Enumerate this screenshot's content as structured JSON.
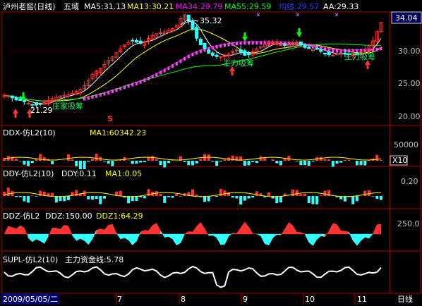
{
  "header": {
    "title": "泸州老窖(日线)",
    "subtitle": "五域",
    "indicators": [
      {
        "label": "MA5:31.13",
        "color": "#ffffff"
      },
      {
        "label": "MA13:30.21",
        "color": "#ffff00"
      },
      {
        "label": "MA34:29.79",
        "color": "#ff00ff"
      },
      {
        "label": "MA55:29.59",
        "color": "#00ff00"
      },
      {
        "label": "均线:29.57",
        "color": "#3333ff"
      },
      {
        "label": "AA:29.33",
        "color": "#ffffff"
      }
    ]
  },
  "price_panel": {
    "current_price": "34.04",
    "peak_label": "35.32",
    "low_label": "21.29",
    "axis_labels": [
      "30.00",
      "25.00",
      "20.00"
    ],
    "signal_text": "S",
    "note_texts": [
      "庄家吸筹",
      "主力吸筹",
      "主力吸筹"
    ]
  },
  "ddx_panel": {
    "name": "DDX-仿L2(10)",
    "ma_label": "MA1:60342.23",
    "axis_label": "50000",
    "unit_label": "X10"
  },
  "ddy_panel": {
    "name": "DDY-仿L2(10)",
    "value_label": "DDY:0.11",
    "ma_label": "MA1:0.05",
    "axis_label": "0.20"
  },
  "ddz_panel": {
    "name": "DDZ-仿L2",
    "value_label": "DDZ:150.00",
    "ddz1_label": "DDZ1:64.29",
    "axis_label": "250.0"
  },
  "supl_panel": {
    "name": "SUPL-仿L2(10)",
    "value_label": "主力资金线:5.78"
  },
  "time_axis": {
    "start_date": "2009/05/05/二",
    "months": [
      "7",
      "8",
      "9",
      "10",
      "11"
    ],
    "period_label": "日线"
  },
  "colors": {
    "up": "#ff3333",
    "down": "#33ffff",
    "border": "#b00000",
    "ma5": "#ffffff",
    "ma13": "#ffff00",
    "ma34": "#ff00ff",
    "ma55": "#00ff00"
  },
  "chart_data": {
    "type": "candlestick",
    "title": "泸州老窖(日线)",
    "price_axis_ticks": [
      20,
      25,
      30
    ],
    "price_range": [
      18.5,
      35.5
    ],
    "annotated_high": 35.32,
    "annotated_low": 21.29,
    "last_price": 34.04,
    "close_series": [
      22.9,
      22.8,
      22.5,
      22.2,
      22.1,
      21.9,
      21.7,
      21.5,
      21.4,
      21.5,
      21.8,
      22.1,
      22.4,
      22.6,
      22.8,
      22.9,
      23.0,
      23.2,
      23.5,
      23.8,
      24.4,
      25.2,
      26.1,
      26.6,
      27.0,
      27.6,
      28.2,
      28.8,
      29.4,
      30.0,
      30.6,
      31.0,
      31.2,
      31.0,
      30.8,
      31.1,
      31.6,
      32.0,
      32.3,
      32.5,
      32.6,
      32.8,
      33.1,
      33.6,
      34.6,
      35.2,
      34.2,
      33.0,
      31.6,
      30.6,
      30.0,
      29.3,
      29.0,
      28.8,
      28.8,
      28.9,
      29.2,
      29.6,
      29.8,
      29.5,
      29.0,
      29.1,
      29.6,
      30.0,
      30.3,
      30.7,
      30.9,
      31.0,
      30.8,
      30.6,
      30.5,
      30.7,
      30.9,
      31.0,
      30.6,
      30.2,
      30.0,
      30.0,
      29.9,
      29.6,
      29.3,
      29.1,
      29.0,
      29.2,
      29.4,
      29.3,
      29.1,
      29.0,
      29.2,
      29.5,
      29.8,
      30.3,
      31.2,
      32.6,
      34.0
    ],
    "moving_averages": {
      "MA5": 31.13,
      "MA13": 30.21,
      "MA34": 29.79,
      "MA55": 29.59,
      "均线": 29.57,
      "AA": 29.33
    },
    "sub_indicators": {
      "DDX_MA1": 60342.23,
      "DDY": 0.11,
      "DDY_MA1": 0.05,
      "DDZ": 150.0,
      "DDZ1": 64.29,
      "SUPL": 5.78
    },
    "x_axis_start": "2009/05/05",
    "x_axis_months": [
      "7",
      "8",
      "9",
      "10",
      "11"
    ]
  }
}
